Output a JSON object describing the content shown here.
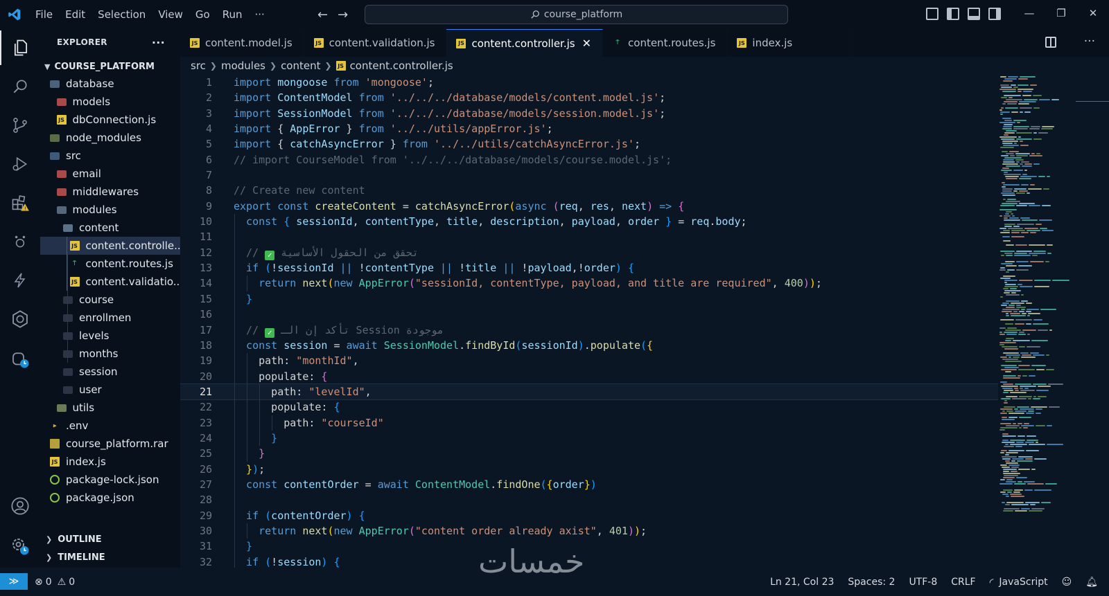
{
  "titlebar": {
    "menu": [
      "File",
      "Edit",
      "Selection",
      "View",
      "Go",
      "Run",
      "···"
    ],
    "search_text": "course_platform"
  },
  "explorer": {
    "title": "EXPLORER",
    "more": "···",
    "root": "COURSE_PLATFORM",
    "items": [
      {
        "label": "database",
        "depth": 0,
        "kind": "folder-db"
      },
      {
        "label": "models",
        "depth": 1,
        "kind": "folder-red"
      },
      {
        "label": "dbConnection.js",
        "depth": 1,
        "kind": "js"
      },
      {
        "label": "node_modules",
        "depth": 0,
        "kind": "folder-nm"
      },
      {
        "label": "src",
        "depth": 0,
        "kind": "folder-src"
      },
      {
        "label": "email",
        "depth": 1,
        "kind": "folder-red"
      },
      {
        "label": "middlewares",
        "depth": 1,
        "kind": "folder-red"
      },
      {
        "label": "modules",
        "depth": 1,
        "kind": "folder-mod"
      },
      {
        "label": "content",
        "depth": 2,
        "kind": "folder-cnt"
      },
      {
        "label": "content.controlle...",
        "depth": 3,
        "kind": "js",
        "selected": true
      },
      {
        "label": "content.routes.js",
        "depth": 3,
        "kind": "route"
      },
      {
        "label": "content.validatio...",
        "depth": 3,
        "kind": "js"
      },
      {
        "label": "course",
        "depth": 2,
        "kind": "folder"
      },
      {
        "label": "enrollmen",
        "depth": 2,
        "kind": "folder"
      },
      {
        "label": "levels",
        "depth": 2,
        "kind": "folder"
      },
      {
        "label": "months",
        "depth": 2,
        "kind": "folder"
      },
      {
        "label": "session",
        "depth": 2,
        "kind": "folder"
      },
      {
        "label": "user",
        "depth": 2,
        "kind": "folder"
      },
      {
        "label": "utils",
        "depth": 1,
        "kind": "folder-utl"
      },
      {
        "label": ".env",
        "depth": 0,
        "kind": "env"
      },
      {
        "label": "course_platform.rar",
        "depth": 0,
        "kind": "rar"
      },
      {
        "label": "index.js",
        "depth": 0,
        "kind": "js"
      },
      {
        "label": "package-lock.json",
        "depth": 0,
        "kind": "json"
      },
      {
        "label": "package.json",
        "depth": 0,
        "kind": "json"
      }
    ],
    "outline": "OUTLINE",
    "timeline": "TIMELINE"
  },
  "tabs": [
    {
      "label": "content.model.js",
      "icon": "js"
    },
    {
      "label": "content.validation.js",
      "icon": "js"
    },
    {
      "label": "content.controller.js",
      "icon": "js",
      "active": true
    },
    {
      "label": "content.routes.js",
      "icon": "route"
    },
    {
      "label": "index.js",
      "icon": "js"
    }
  ],
  "breadcrumb": [
    "src",
    "modules",
    "content",
    "content.controller.js"
  ],
  "editor": {
    "current_line": 21,
    "lines": [
      {
        "n": "1",
        "t": [
          [
            "kw",
            "import"
          ],
          [
            "pu",
            " "
          ],
          [
            "var",
            "mongoose"
          ],
          [
            "pu",
            " "
          ],
          [
            "kw",
            "from"
          ],
          [
            "pu",
            " "
          ],
          [
            "str",
            "'mongoose'"
          ],
          [
            "pu",
            ";"
          ]
        ]
      },
      {
        "n": "2",
        "t": [
          [
            "kw",
            "import"
          ],
          [
            "pu",
            " "
          ],
          [
            "var",
            "ContentModel"
          ],
          [
            "pu",
            " "
          ],
          [
            "kw",
            "from"
          ],
          [
            "pu",
            " "
          ],
          [
            "str",
            "'../../../database/models/content.model.js'"
          ],
          [
            "pu",
            ";"
          ]
        ]
      },
      {
        "n": "3",
        "t": [
          [
            "kw",
            "import"
          ],
          [
            "pu",
            " "
          ],
          [
            "var",
            "SessionModel"
          ],
          [
            "pu",
            " "
          ],
          [
            "kw",
            "from"
          ],
          [
            "pu",
            " "
          ],
          [
            "str",
            "'../../../database/models/session.model.js'"
          ],
          [
            "pu",
            ";"
          ]
        ]
      },
      {
        "n": "4",
        "t": [
          [
            "kw",
            "import"
          ],
          [
            "pu",
            " { "
          ],
          [
            "var",
            "AppError"
          ],
          [
            "pu",
            " } "
          ],
          [
            "kw",
            "from"
          ],
          [
            "pu",
            " "
          ],
          [
            "str",
            "'../../utils/appError.js'"
          ],
          [
            "pu",
            ";"
          ]
        ]
      },
      {
        "n": "5",
        "t": [
          [
            "kw",
            "import"
          ],
          [
            "pu",
            " { "
          ],
          [
            "var",
            "catchAsyncError"
          ],
          [
            "pu",
            " } "
          ],
          [
            "kw",
            "from"
          ],
          [
            "pu",
            " "
          ],
          [
            "str",
            "'../../utils/catchAsyncError.js'"
          ],
          [
            "pu",
            ";"
          ]
        ]
      },
      {
        "n": "6",
        "t": [
          [
            "cmtd",
            "// import CourseModel from '../../../database/models/course.model.js';"
          ]
        ]
      },
      {
        "n": "7",
        "t": []
      },
      {
        "n": "8",
        "t": [
          [
            "cmtd",
            "// Create new content"
          ]
        ]
      },
      {
        "n": "9",
        "t": [
          [
            "kw",
            "export"
          ],
          [
            "pu",
            " "
          ],
          [
            "kw",
            "const"
          ],
          [
            "pu",
            " "
          ],
          [
            "fn",
            "createContent"
          ],
          [
            "pu",
            " = "
          ],
          [
            "fn",
            "catchAsyncError"
          ],
          [
            "br1",
            "("
          ],
          [
            "kw",
            "async"
          ],
          [
            "pu",
            " "
          ],
          [
            "br2",
            "("
          ],
          [
            "var",
            "req"
          ],
          [
            "pu",
            ", "
          ],
          [
            "var",
            "res"
          ],
          [
            "pu",
            ", "
          ],
          [
            "var",
            "next"
          ],
          [
            "br2",
            ")"
          ],
          [
            "pu",
            " "
          ],
          [
            "kw",
            "=>"
          ],
          [
            "pu",
            " "
          ],
          [
            "br2",
            "{"
          ]
        ]
      },
      {
        "n": "10",
        "i": 1,
        "t": [
          [
            "kw",
            "const"
          ],
          [
            "pu",
            " "
          ],
          [
            "br3",
            "{"
          ],
          [
            "pu",
            " "
          ],
          [
            "var",
            "sessionId"
          ],
          [
            "pu",
            ", "
          ],
          [
            "var",
            "contentType"
          ],
          [
            "pu",
            ", "
          ],
          [
            "var",
            "title"
          ],
          [
            "pu",
            ", "
          ],
          [
            "var",
            "description"
          ],
          [
            "pu",
            ", "
          ],
          [
            "var",
            "payload"
          ],
          [
            "pu",
            ", "
          ],
          [
            "var",
            "order"
          ],
          [
            "pu",
            " "
          ],
          [
            "br3",
            "}"
          ],
          [
            "pu",
            " = "
          ],
          [
            "var",
            "req"
          ],
          [
            "pu",
            "."
          ],
          [
            "var",
            "body"
          ],
          [
            "pu",
            ";"
          ]
        ]
      },
      {
        "n": "11",
        "i": 1,
        "t": []
      },
      {
        "n": "12",
        "i": 1,
        "t": [
          [
            "cmtd",
            "// "
          ],
          [
            "chk",
            "✓"
          ],
          [
            "cmtd",
            " تحقق من الحقول الأساسية"
          ]
        ]
      },
      {
        "n": "13",
        "i": 1,
        "t": [
          [
            "kw",
            "if"
          ],
          [
            "pu",
            " "
          ],
          [
            "br3",
            "("
          ],
          [
            "pu",
            "!"
          ],
          [
            "var",
            "sessionId"
          ],
          [
            "pu",
            " "
          ],
          [
            "kw",
            "||"
          ],
          [
            "pu",
            " !"
          ],
          [
            "var",
            "contentType"
          ],
          [
            "pu",
            " "
          ],
          [
            "kw",
            "||"
          ],
          [
            "pu",
            " !"
          ],
          [
            "var",
            "title"
          ],
          [
            "pu",
            " "
          ],
          [
            "kw",
            "||"
          ],
          [
            "pu",
            " !"
          ],
          [
            "var",
            "payload"
          ],
          [
            "pu",
            ",!"
          ],
          [
            "var",
            "order"
          ],
          [
            "br3",
            ")"
          ],
          [
            "pu",
            " "
          ],
          [
            "br3",
            "{"
          ]
        ]
      },
      {
        "n": "14",
        "i": 2,
        "t": [
          [
            "kw",
            "return"
          ],
          [
            "pu",
            " "
          ],
          [
            "fn",
            "next"
          ],
          [
            "br1",
            "("
          ],
          [
            "kw",
            "new"
          ],
          [
            "pu",
            " "
          ],
          [
            "cls",
            "AppError"
          ],
          [
            "br2",
            "("
          ],
          [
            "str",
            "\"sessionId, contentType, payload, and title are required\""
          ],
          [
            "pu",
            ", "
          ],
          [
            "num2",
            "400"
          ],
          [
            "br2",
            ")"
          ],
          [
            "br1",
            ")"
          ],
          [
            "pu",
            ";"
          ]
        ]
      },
      {
        "n": "15",
        "i": 1,
        "t": [
          [
            "br3",
            "}"
          ]
        ]
      },
      {
        "n": "16",
        "i": 1,
        "t": []
      },
      {
        "n": "17",
        "i": 1,
        "t": [
          [
            "cmtd",
            "// "
          ],
          [
            "chk",
            "✓"
          ],
          [
            "cmtd",
            " تأكد إن الـ Session موجودة"
          ]
        ]
      },
      {
        "n": "18",
        "i": 1,
        "t": [
          [
            "kw",
            "const"
          ],
          [
            "pu",
            " "
          ],
          [
            "var",
            "session"
          ],
          [
            "pu",
            " = "
          ],
          [
            "kw",
            "await"
          ],
          [
            "pu",
            " "
          ],
          [
            "cls",
            "SessionModel"
          ],
          [
            "pu",
            "."
          ],
          [
            "fn",
            "findById"
          ],
          [
            "br3",
            "("
          ],
          [
            "var",
            "sessionId"
          ],
          [
            "br3",
            ")"
          ],
          [
            "pu",
            "."
          ],
          [
            "fn",
            "populate"
          ],
          [
            "br3",
            "("
          ],
          [
            "br1",
            "{"
          ]
        ]
      },
      {
        "n": "19",
        "i": 2,
        "t": [
          [
            "pu",
            "path: "
          ],
          [
            "str",
            "\"monthId\""
          ],
          [
            "pu",
            ","
          ]
        ]
      },
      {
        "n": "20",
        "i": 2,
        "t": [
          [
            "pu",
            "populate: "
          ],
          [
            "br2",
            "{"
          ]
        ]
      },
      {
        "n": "21",
        "i": 3,
        "t": [
          [
            "pu",
            "path: "
          ],
          [
            "str",
            "\"levelId\""
          ],
          [
            "pu",
            ","
          ]
        ]
      },
      {
        "n": "22",
        "i": 3,
        "t": [
          [
            "pu",
            "populate: "
          ],
          [
            "br3",
            "{"
          ]
        ]
      },
      {
        "n": "23",
        "i": 4,
        "t": [
          [
            "pu",
            "path: "
          ],
          [
            "str",
            "\"courseId\""
          ]
        ]
      },
      {
        "n": "24",
        "i": 3,
        "t": [
          [
            "br3",
            "}"
          ]
        ]
      },
      {
        "n": "25",
        "i": 2,
        "t": [
          [
            "br2",
            "}"
          ]
        ]
      },
      {
        "n": "26",
        "i": 1,
        "t": [
          [
            "br1",
            "}"
          ],
          [
            "br3",
            ")"
          ],
          [
            "pu",
            ";"
          ]
        ]
      },
      {
        "n": "27",
        "i": 1,
        "t": [
          [
            "kw",
            "const"
          ],
          [
            "pu",
            " "
          ],
          [
            "var",
            "contentOrder"
          ],
          [
            "pu",
            " = "
          ],
          [
            "kw",
            "await"
          ],
          [
            "pu",
            " "
          ],
          [
            "cls",
            "ContentModel"
          ],
          [
            "pu",
            "."
          ],
          [
            "fn",
            "findOne"
          ],
          [
            "br3",
            "("
          ],
          [
            "br1",
            "{"
          ],
          [
            "var",
            "order"
          ],
          [
            "br1",
            "}"
          ],
          [
            "br3",
            ")"
          ]
        ]
      },
      {
        "n": "28",
        "i": 1,
        "t": []
      },
      {
        "n": "29",
        "i": 1,
        "t": [
          [
            "kw",
            "if"
          ],
          [
            "pu",
            " "
          ],
          [
            "br3",
            "("
          ],
          [
            "var",
            "contentOrder"
          ],
          [
            "br3",
            ")"
          ],
          [
            "pu",
            " "
          ],
          [
            "br3",
            "{"
          ]
        ]
      },
      {
        "n": "30",
        "i": 2,
        "t": [
          [
            "kw",
            "return"
          ],
          [
            "pu",
            " "
          ],
          [
            "fn",
            "next"
          ],
          [
            "br1",
            "("
          ],
          [
            "kw",
            "new"
          ],
          [
            "pu",
            " "
          ],
          [
            "cls",
            "AppError"
          ],
          [
            "br2",
            "("
          ],
          [
            "str",
            "\"content order already axist\""
          ],
          [
            "pu",
            ", "
          ],
          [
            "num2",
            "401"
          ],
          [
            "br2",
            ")"
          ],
          [
            "br1",
            ")"
          ],
          [
            "pu",
            ";"
          ]
        ]
      },
      {
        "n": "31",
        "i": 1,
        "t": [
          [
            "br3",
            "}"
          ]
        ]
      },
      {
        "n": "32",
        "i": 1,
        "t": [
          [
            "kw",
            "if"
          ],
          [
            "pu",
            " "
          ],
          [
            "br3",
            "("
          ],
          [
            "pu",
            "!"
          ],
          [
            "var",
            "session"
          ],
          [
            "br3",
            ")"
          ],
          [
            "pu",
            " "
          ],
          [
            "br3",
            "{"
          ]
        ]
      }
    ]
  },
  "statusbar": {
    "errors": "0",
    "warnings": "0",
    "position": "Ln 21, Col 23",
    "spaces": "Spaces: 2",
    "encoding": "UTF-8",
    "eol": "CRLF",
    "language": "JavaScript",
    "watermark": "خمسات"
  },
  "colors": {
    "accent": "#3b82f6",
    "background": "#0b1624",
    "sidebar": "#08101c",
    "selection": "#23324a",
    "remote": "#1d8fd6"
  }
}
